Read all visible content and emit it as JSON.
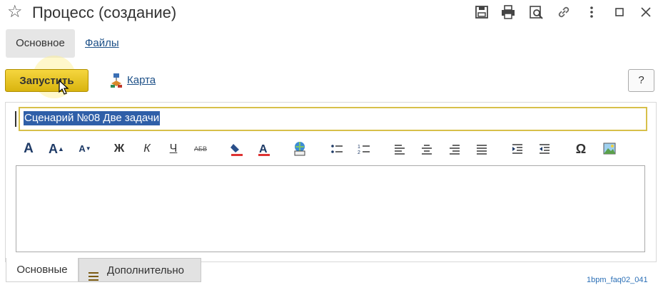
{
  "window": {
    "title": "Процесс (создание)"
  },
  "form_tabs": [
    {
      "label": "Основное"
    },
    {
      "label": "Файлы"
    }
  ],
  "command_bar": {
    "start_label": "Запустить",
    "map_label": "Карта",
    "help_label": "?"
  },
  "subject": {
    "value": "Сценарий №08 Две задачи"
  },
  "format_toolbar": {
    "bold_label": "Ж",
    "italic_label": "К",
    "underline_label": "Ч",
    "strike_label": "АБВ",
    "special_char_label": "Ω"
  },
  "bottom_tabs": [
    {
      "label": "Основные"
    },
    {
      "label": "Дополнительно"
    }
  ],
  "watermark": "1bpm_faq02_041",
  "colors": {
    "accent": "#d9b40f",
    "selection": "#2f5fa8",
    "link": "#1c4f87"
  }
}
